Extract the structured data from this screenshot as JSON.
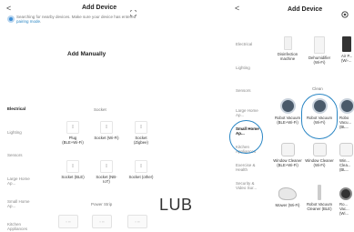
{
  "left": {
    "back": "<",
    "title": "Add Device",
    "scan_text": "Searching for nearby devices. Make sure your device has entered pairing mode.",
    "scan_link": "pairing mode",
    "manual": "Add Manually",
    "categories": [
      "Electrical",
      "Lighting",
      "Sensors",
      "Large Home Ap...",
      "Small Home Ap...",
      "Kitchen Appliances"
    ],
    "sections": {
      "socket": "Socket",
      "power_strip": "Power Strip"
    },
    "row1": [
      {
        "label": "Plug (BLE+Wi-Fi)"
      },
      {
        "label": "Socket (Wi-Fi)"
      },
      {
        "label": "Socket (Zigbee)"
      }
    ],
    "row2": [
      {
        "label": "Socket (BLE)"
      },
      {
        "label": "Socket (NB-IoT)"
      },
      {
        "label": "Socket (other)"
      }
    ]
  },
  "middle_text": "LUB",
  "right": {
    "back": "<",
    "title": "Add Device",
    "categories": [
      "Electrical",
      "Lighting",
      "Sensors",
      "Large Home Ap...",
      "Small Home Ap...",
      "Kitchen Appliances",
      "Exercise & Health",
      "Security & Video Sur..."
    ],
    "sections": {
      "clean": "Clean"
    },
    "row1": [
      {
        "label": "Disinfection machine"
      },
      {
        "label": "Dehumidifier (Wi-Fi)"
      },
      {
        "label": "Air P... (Wi-..."
      }
    ],
    "row2": [
      {
        "label": "Robot Vacuum (BLE+Wi-Fi)"
      },
      {
        "label": "Robot Vacuum (Wi-Fi)"
      },
      {
        "label": "Robo Vacu... (BL..."
      }
    ],
    "row3": [
      {
        "label": "Window Cleaner (BLE+Wi-Fi)"
      },
      {
        "label": "Window Cleaner (Wi-Fi)"
      },
      {
        "label": "Win... Clea... (BL..."
      }
    ],
    "row4": [
      {
        "label": "Mower (Wi-Fi)"
      },
      {
        "label": "Robot Vacuum Cleaner (BLE)"
      },
      {
        "label": "Ro... Vac... (Wi..."
      }
    ]
  }
}
